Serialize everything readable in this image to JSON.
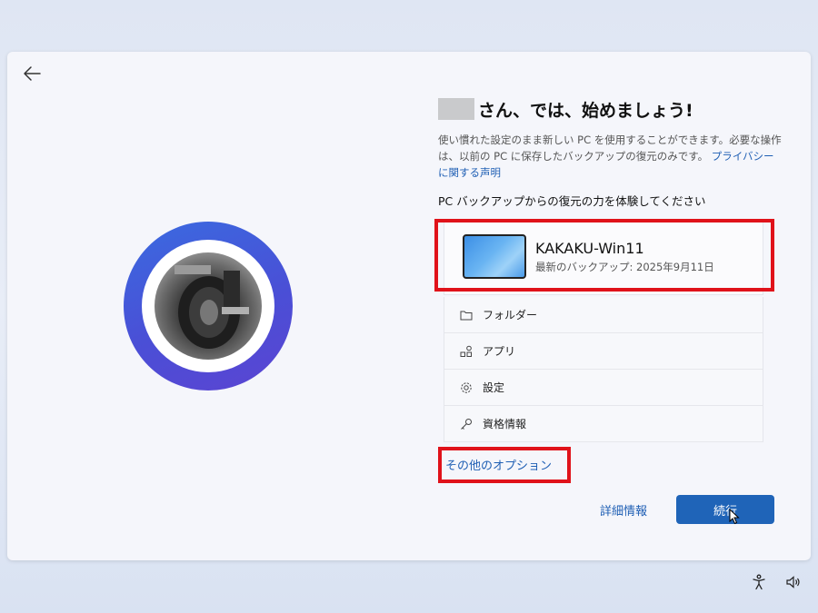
{
  "header": {
    "heading": "さん、では、始めましょう!",
    "description": "使い慣れた設定のまま新しい PC を使用することができます。必要な操作は、以前の PC に保存したバックアップの復元のみです。",
    "privacy_link": "プライバシーに関する声明",
    "subheading": "PC バックアップからの復元の力を体験してください"
  },
  "device": {
    "name": "KAKAKU-Win11",
    "last_backup": "最新のバックアップ: 2025年9月11日"
  },
  "backup_items": [
    {
      "label": "フォルダー",
      "icon": "folder-icon"
    },
    {
      "label": "アプリ",
      "icon": "apps-icon"
    },
    {
      "label": "設定",
      "icon": "settings-gear-icon"
    },
    {
      "label": "資格情報",
      "icon": "key-icon"
    }
  ],
  "actions": {
    "more_options": "その他のオプション",
    "details": "詳細情報",
    "continue": "続行"
  },
  "colors": {
    "accent": "#1f64b8",
    "link": "#1f5fb4",
    "highlight": "#e0121a"
  }
}
